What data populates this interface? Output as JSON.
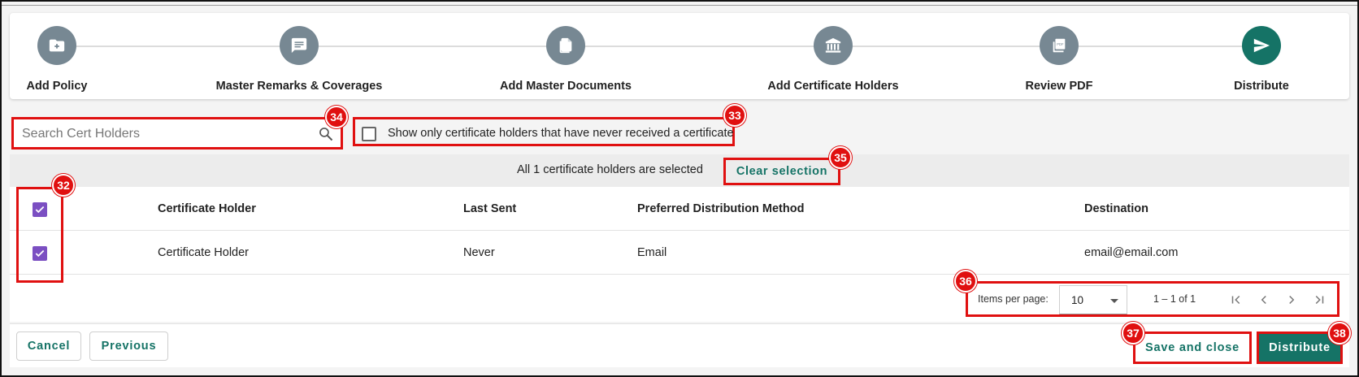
{
  "stepper": {
    "steps": [
      {
        "label": "Add Policy",
        "icon": "folder-plus-icon"
      },
      {
        "label": "Master Remarks & Coverages",
        "icon": "comment-icon"
      },
      {
        "label": "Add Master Documents",
        "icon": "documents-icon"
      },
      {
        "label": "Add Certificate Holders",
        "icon": "bank-icon"
      },
      {
        "label": "Review PDF",
        "icon": "pdf-icon"
      },
      {
        "label": "Distribute",
        "icon": "send-icon"
      }
    ],
    "active_color": "#157366",
    "inactive_color": "#778893"
  },
  "filters": {
    "search_placeholder": "Search Cert Holders",
    "never_received_label": "Show only certificate holders that have never received a certificate"
  },
  "selection": {
    "text": "All 1 certificate holders are selected",
    "clear_label": "Clear selection"
  },
  "table": {
    "headers": [
      "Certificate Holder",
      "Last Sent",
      "Preferred Distribution Method",
      "Destination"
    ],
    "rows": [
      {
        "holder": "Certificate Holder",
        "last_sent": "Never",
        "method": "Email",
        "destination": "email@email.com"
      }
    ]
  },
  "paginator": {
    "items_per_page_label": "Items per page:",
    "page_size": "10",
    "range": "1 – 1 of 1"
  },
  "footer": {
    "cancel": "Cancel",
    "previous": "Previous",
    "save_close": "Save and close",
    "distribute": "Distribute"
  },
  "badges": [
    "32",
    "33",
    "34",
    "35",
    "36",
    "37",
    "38"
  ],
  "colors": {
    "accent": "#157366",
    "checkbox": "#7b4fc2",
    "annotation": "#e01010"
  }
}
